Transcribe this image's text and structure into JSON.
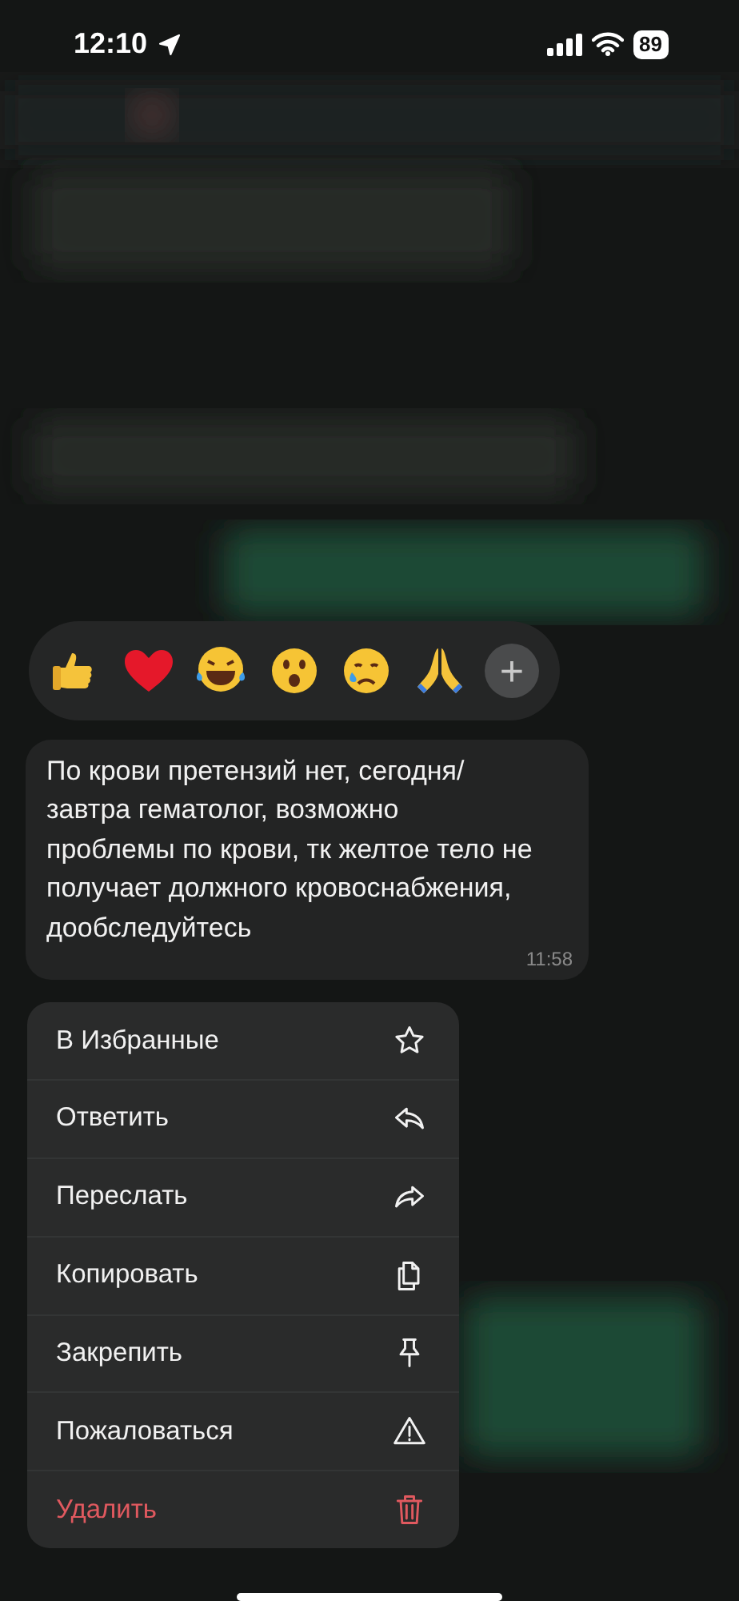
{
  "status_bar": {
    "time": "12:10",
    "battery": "89"
  },
  "reactions": {
    "more": "+"
  },
  "message": {
    "text": "По крови претензий нет, сегодня/ завтра гематолог, возможно проблемы по крови, тк желтое тело не получает должного кровоснабжения, дообследуйтесь",
    "time": "11:58"
  },
  "menu": [
    {
      "label": "В Избранные",
      "kind": "normal"
    },
    {
      "label": "Ответить",
      "kind": "normal"
    },
    {
      "label": "Переслать",
      "kind": "normal"
    },
    {
      "label": "Копировать",
      "kind": "normal"
    },
    {
      "label": "Закрепить",
      "kind": "normal"
    },
    {
      "label": "Пожаловаться",
      "kind": "normal"
    },
    {
      "label": "Удалить",
      "kind": "destructive"
    }
  ]
}
